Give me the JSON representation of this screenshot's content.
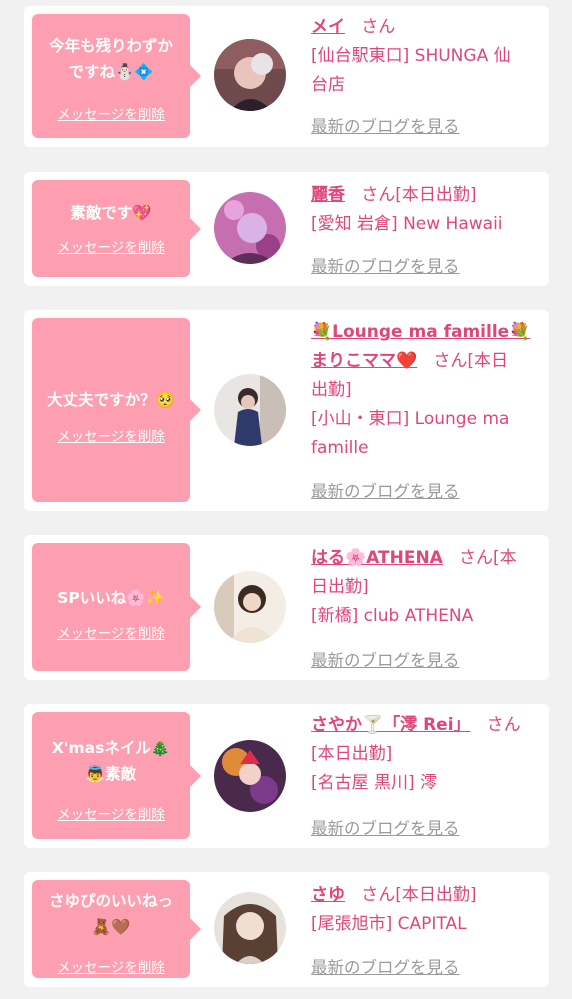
{
  "delete_label": "メッセージを削除",
  "blog_label": "最新のブログを見る",
  "colors": {
    "accent": "#e0467a",
    "bubble": "#fd9fb0",
    "background": "#f1f1f1",
    "muted": "#9a9a9a"
  },
  "cards": [
    {
      "message_lines": [
        "今年も残りわずか",
        "ですね☃️💠"
      ],
      "name": "メイ",
      "san": "さん",
      "line2": "[仙台駅東口] SHUNGA 仙",
      "line3": "台店"
    },
    {
      "message_lines": [
        "素敵です💖"
      ],
      "name": "麗香",
      "san": "さん[本日出勤]",
      "line2": "[愛知 岩倉] New Hawaii"
    },
    {
      "message_lines": [
        "大丈夫ですか？🥺"
      ],
      "name_line1": "💐Lounge ma famille💐",
      "name_line2": "まりこママ❤️",
      "san": "さん[本日",
      "line2": "出勤]",
      "line3": "[小山・東口] Lounge ma",
      "line4": "famille"
    },
    {
      "message_lines": [
        "SPいいね🌸✨"
      ],
      "name": "はる🌸ATHENA",
      "san": "さん[本",
      "line2": "日出勤]",
      "line3": "[新橋] club ATHENA"
    },
    {
      "message_lines": [
        "X'masネイル🎄",
        "👼素敵"
      ],
      "name": "さやか🍸「澪 Rei」",
      "san": "さん",
      "line2": "[本日出勤]",
      "line3": "[名古屋 黒川] 澪"
    },
    {
      "message_lines": [
        "さゆぴのいいねっ",
        "🧸🤎"
      ],
      "name": "さゆ",
      "san": "さん[本日出勤]",
      "line2": "[尾張旭市] CAPITAL"
    }
  ]
}
